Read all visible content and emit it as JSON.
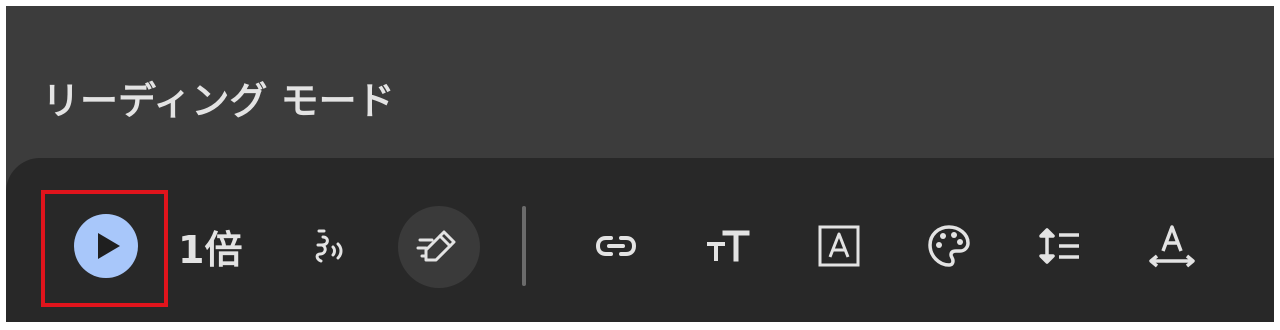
{
  "panel": {
    "title": "リーディング モード"
  },
  "toolbar": {
    "play": {
      "icon": "play-icon",
      "state": "selected"
    },
    "speed": {
      "label": "1倍"
    },
    "voice": {
      "icon": "voice-icon"
    },
    "highlight": {
      "icon": "highlighter-icon"
    },
    "links": {
      "icon": "link-icon"
    },
    "font_size": {
      "icon": "text-size-icon"
    },
    "font": {
      "icon": "font-icon"
    },
    "theme": {
      "icon": "palette-icon"
    },
    "line_spacing": {
      "icon": "line-spacing-icon"
    },
    "letter_spacing": {
      "icon": "letter-spacing-icon"
    }
  },
  "colors": {
    "panel_bg": "#3c3c3c",
    "toolbar_bg": "#282828",
    "icon": "#e3e3e3",
    "play_accent": "#a8c7fa",
    "callout": "#e0141c"
  }
}
